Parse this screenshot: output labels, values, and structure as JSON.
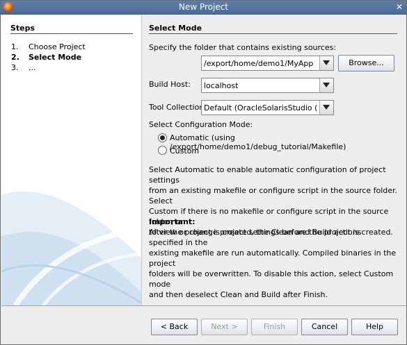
{
  "window": {
    "title": "New Project"
  },
  "steps": {
    "title": "Steps",
    "items": [
      {
        "num": "1.",
        "label": "Choose Project"
      },
      {
        "num": "2.",
        "label": "Select Mode"
      },
      {
        "num": "3.",
        "label": "..."
      }
    ]
  },
  "main": {
    "title": "Select Mode",
    "folder_label": "Specify the folder that contains existing sources:",
    "folder_value": "/export/home/demo1/MyApp",
    "browse_label": "Browse...",
    "build_host_label": "Build Host:",
    "build_host_value": "localhost",
    "tool_collection_label": "Tool Collection:",
    "tool_collection_value": "Default (OracleSolarisStudio (Or...",
    "config_mode_label": "Select Configuration Mode:",
    "radio_automatic": "Automatic (using /export/home/demo1/debug_tutorial/Makefile)",
    "radio_custom": "Custom",
    "selected_mode": "automatic",
    "description_lines": [
      "Select Automatic to enable automatic configuration of project settings",
      "from an existing makefile or configure script in the source folder. Select",
      "Custom if there is no makefile or configure script in the source folder, or",
      "to view or change project settings before the project is created."
    ],
    "important_heading": "Important:",
    "important_lines": [
      "After the project is created, the Clean and Build actions specified in the",
      "existing makefile are run automatically. Compiled binaries in the project",
      "folders will be overwritten. To disable this action, select Custom mode",
      "and then deselect Clean and Build after Finish."
    ]
  },
  "buttons": {
    "back": "< Back",
    "next": "Next >",
    "finish": "Finish",
    "cancel": "Cancel",
    "help": "Help"
  }
}
